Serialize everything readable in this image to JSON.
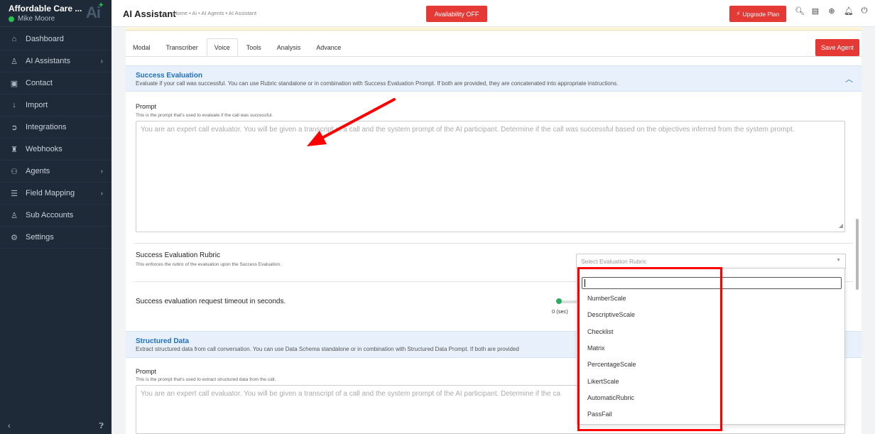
{
  "sidebar": {
    "brand_name": "Affordable Care ...",
    "user_name": "Mike Moore",
    "logo_text": "Ai",
    "items": [
      {
        "label": "Dashboard",
        "icon": "home-icon",
        "has_chevron": false
      },
      {
        "label": "AI Assistants",
        "icon": "user-icon",
        "has_chevron": true
      },
      {
        "label": "Contact",
        "icon": "contact-card-icon",
        "has_chevron": false
      },
      {
        "label": "Import",
        "icon": "import-arrow-icon",
        "has_chevron": false
      },
      {
        "label": "Integrations",
        "icon": "plug-icon",
        "has_chevron": false
      },
      {
        "label": "Webhooks",
        "icon": "webhook-icon",
        "has_chevron": false
      },
      {
        "label": "Agents",
        "icon": "users-icon",
        "has_chevron": true
      },
      {
        "label": "Field Mapping",
        "icon": "database-icon",
        "has_chevron": true
      },
      {
        "label": "Sub Accounts",
        "icon": "user-icon",
        "has_chevron": false
      },
      {
        "label": "Settings",
        "icon": "gear-icon",
        "has_chevron": false
      }
    ]
  },
  "topbar": {
    "title": "AI Assistant",
    "breadcrumb": "Home • Ai • AI Agents • AI Assistant",
    "availability_label": "Availability OFF",
    "upgrade_label": "Upgrade Plan",
    "icons": [
      "search-icon",
      "notes-icon",
      "plus-circle-icon",
      "bell-icon",
      "power-icon"
    ]
  },
  "tabs": {
    "items": [
      "Modal",
      "Transcriber",
      "Voice",
      "Tools",
      "Analysis",
      "Advance"
    ],
    "active": "Voice",
    "save_label": "Save Agent"
  },
  "success_evaluation": {
    "title": "Success Evaluation",
    "description": "Evaluate if your call was successful. You can use Rubric standalone or in combination with Success Evaluation Prompt. If both are provided, they are concatenated into appropriate instructions.",
    "prompt_label": "Prompt",
    "prompt_help": "This is the prompt that's used to evaluate if the call was successful.",
    "prompt_placeholder": "You are an expert call evaluator. You will be given a transcript of a call and the system prompt of the AI participant. Determine if the call was successful based on the objectives inferred from the system prompt.",
    "rubric_label": "Success Evaluation Rubric",
    "rubric_help": "This enforces the rubric of the evaluation upon the Success Evaluation.",
    "rubric_placeholder": "Select Evaluation Rubric",
    "timeout_label": "Success evaluation request timeout in seconds.",
    "timeout_value": "0 (sec)"
  },
  "rubric_dropdown": {
    "search_value": "",
    "options": [
      "NumberScale",
      "DescriptiveScale",
      "Checklist",
      "Matrix",
      "PercentageScale",
      "LikertScale",
      "AutomaticRubric",
      "PassFail"
    ]
  },
  "structured_data": {
    "title": "Structured Data",
    "description": "Extract structured data from call conversation. You can use Data Schema standalone or in combination with Structured Data Prompt. If both are provided",
    "prompt_label": "Prompt",
    "prompt_help": "This is the prompt that's used to extract structured data from the call.",
    "prompt_placeholder": "You are an expert call evaluator. You will be given a transcript of a call and the system prompt of the AI participant. Determine if the ca"
  },
  "colors": {
    "accent_red": "#e53935",
    "section_blue": "#1f6fbf",
    "sidebar_bg": "#1e2a38",
    "annotation_red": "#ff0000"
  }
}
